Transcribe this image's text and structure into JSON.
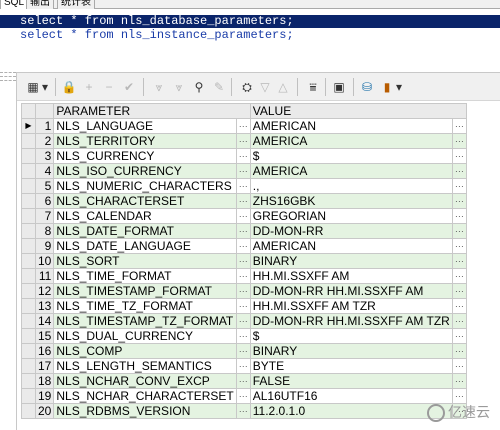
{
  "tabs": [
    "SQL",
    "输出",
    "统计表"
  ],
  "editor": {
    "line1": "select * from nls_database_parameters;",
    "line2": "select * from nls_instance_parameters;"
  },
  "grid": {
    "headers": [
      "PARAMETER",
      "VALUE"
    ],
    "rows": [
      {
        "num": "1",
        "param": "NLS_LANGUAGE",
        "value": "AMERICAN"
      },
      {
        "num": "2",
        "param": "NLS_TERRITORY",
        "value": "AMERICA"
      },
      {
        "num": "3",
        "param": "NLS_CURRENCY",
        "value": "$"
      },
      {
        "num": "4",
        "param": "NLS_ISO_CURRENCY",
        "value": "AMERICA"
      },
      {
        "num": "5",
        "param": "NLS_NUMERIC_CHARACTERS",
        "value": ".,"
      },
      {
        "num": "6",
        "param": "NLS_CHARACTERSET",
        "value": "ZHS16GBK"
      },
      {
        "num": "7",
        "param": "NLS_CALENDAR",
        "value": "GREGORIAN"
      },
      {
        "num": "8",
        "param": "NLS_DATE_FORMAT",
        "value": "DD-MON-RR"
      },
      {
        "num": "9",
        "param": "NLS_DATE_LANGUAGE",
        "value": "AMERICAN"
      },
      {
        "num": "10",
        "param": "NLS_SORT",
        "value": "BINARY"
      },
      {
        "num": "11",
        "param": "NLS_TIME_FORMAT",
        "value": "HH.MI.SSXFF AM"
      },
      {
        "num": "12",
        "param": "NLS_TIMESTAMP_FORMAT",
        "value": "DD-MON-RR HH.MI.SSXFF AM"
      },
      {
        "num": "13",
        "param": "NLS_TIME_TZ_FORMAT",
        "value": "HH.MI.SSXFF AM TZR"
      },
      {
        "num": "14",
        "param": "NLS_TIMESTAMP_TZ_FORMAT",
        "value": "DD-MON-RR HH.MI.SSXFF AM TZR"
      },
      {
        "num": "15",
        "param": "NLS_DUAL_CURRENCY",
        "value": "$"
      },
      {
        "num": "16",
        "param": "NLS_COMP",
        "value": "BINARY"
      },
      {
        "num": "17",
        "param": "NLS_LENGTH_SEMANTICS",
        "value": "BYTE"
      },
      {
        "num": "18",
        "param": "NLS_NCHAR_CONV_EXCP",
        "value": "FALSE"
      },
      {
        "num": "19",
        "param": "NLS_NCHAR_CHARACTERSET",
        "value": "AL16UTF16"
      },
      {
        "num": "20",
        "param": "NLS_RDBMS_VERSION",
        "value": "11.2.0.1.0"
      }
    ],
    "cell_button": "···",
    "row_indicator": "▶"
  },
  "toolbar_icons": [
    "grid-select-icon",
    "lock-icon",
    "add-record-icon",
    "delete-record-icon",
    "post-record-icon",
    "filter-icon",
    "clear-filter-icon",
    "find-icon",
    "clear-icon",
    "export-icon",
    "next-page-icon",
    "last-page-icon",
    "chart-icon",
    "save-icon",
    "database-icon",
    "bar-chart-icon"
  ],
  "watermark": "亿速云",
  "colors": {
    "selection": "#0a246a",
    "even_row": "#e4f3e1",
    "sql_blue": "#1a3ca8"
  }
}
